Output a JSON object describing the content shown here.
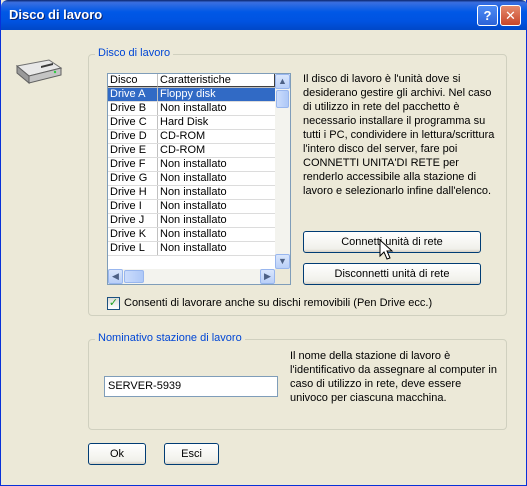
{
  "window": {
    "title": "Disco di lavoro"
  },
  "group_disk": {
    "legend": "Disco di lavoro",
    "columns": [
      "Disco",
      "Caratteristiche"
    ],
    "rows": [
      {
        "drive": "Drive A",
        "type": "Floppy disk"
      },
      {
        "drive": "Drive B",
        "type": "Non installato"
      },
      {
        "drive": "Drive C",
        "type": "Hard Disk"
      },
      {
        "drive": "Drive D",
        "type": "CD-ROM"
      },
      {
        "drive": "Drive E",
        "type": "CD-ROM"
      },
      {
        "drive": "Drive F",
        "type": "Non installato"
      },
      {
        "drive": "Drive G",
        "type": "Non installato"
      },
      {
        "drive": "Drive H",
        "type": "Non installato"
      },
      {
        "drive": "Drive I",
        "type": "Non installato"
      },
      {
        "drive": "Drive J",
        "type": "Non installato"
      },
      {
        "drive": "Drive K",
        "type": "Non installato"
      },
      {
        "drive": "Drive L",
        "type": "Non installato"
      }
    ],
    "selected_row": 0,
    "description_lines": [
      "Il disco di lavoro è l'unità dove si",
      "desiderano gestire gli archivi. Nel caso",
      "di utilizzo in rete del pacchetto è",
      "necessario installare il programma su",
      "tutti i PC, condividere in lettura/scrittura",
      "l'intero disco del server, fare poi",
      "CONNETTI UNITA'DI RETE per",
      "renderlo accessibile alla stazione di",
      "lavoro e selezionarlo infine dall'elenco."
    ],
    "connect_button": "Connetti unità di rete",
    "disconnect_button": "Disconnetti unità di rete",
    "removable_checkbox": {
      "label": "Consenti di lavorare anche su dischi removibili (Pen Drive ecc.)",
      "checked": true
    }
  },
  "group_station": {
    "legend": "Nominativo stazione di lavoro",
    "station_name": "SERVER-5939",
    "description_lines": [
      "Il nome della stazione di lavoro è",
      "l'identificativo da assegnare al computer in",
      "caso di utilizzo in rete, deve essere",
      "univoco per ciascuna macchina."
    ]
  },
  "footer": {
    "ok_button": "Ok",
    "cancel_button": "Esci"
  },
  "colors": {
    "titlebar": "#0053e1",
    "accent_text": "#0046d5",
    "selection": "#316ac5",
    "background": "#ece9d8"
  }
}
